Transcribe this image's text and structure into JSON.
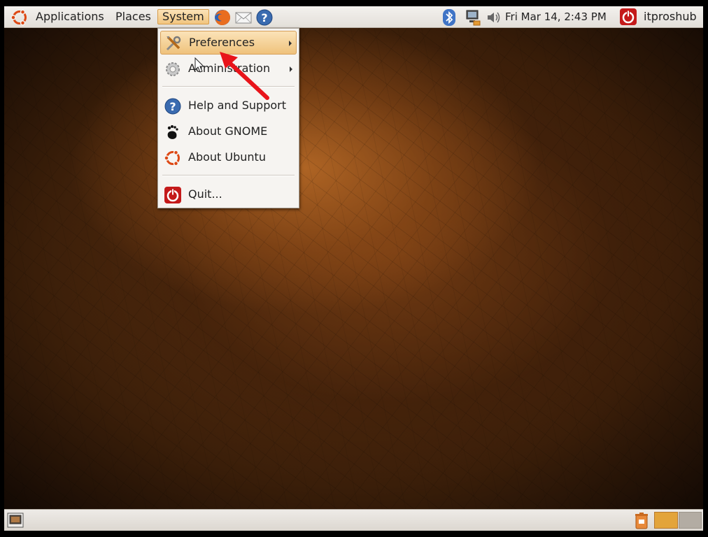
{
  "top_panel": {
    "menus": [
      {
        "label": "Applications"
      },
      {
        "label": "Places"
      },
      {
        "label": "System"
      }
    ],
    "launchers": [
      "firefox-icon",
      "mail-icon",
      "help-icon"
    ],
    "tray": [
      "bluetooth-icon",
      "network-icon",
      "volume-icon"
    ],
    "clock": "Fri Mar 14,  2:43 PM",
    "user": "itproshub"
  },
  "system_menu": {
    "items": [
      {
        "label": "Preferences",
        "submenu": true,
        "highlighted": true,
        "icon": "preferences-icon"
      },
      {
        "label": "Administration",
        "submenu": true,
        "icon": "administration-icon"
      },
      {
        "label": "Help and Support",
        "icon": "help-icon"
      },
      {
        "label": "About GNOME",
        "icon": "gnome-foot-icon"
      },
      {
        "label": "About Ubuntu",
        "icon": "ubuntu-icon"
      },
      {
        "label": "Quit...",
        "icon": "power-icon"
      }
    ]
  },
  "bottom_panel": {
    "left": "show-desktop-icon",
    "right": [
      "trash-icon",
      "workspace-switcher"
    ]
  },
  "colors": {
    "menu_highlight": "#efc27c",
    "annotation_arrow": "#e8141a",
    "wallpaper": "#6a3a14"
  }
}
